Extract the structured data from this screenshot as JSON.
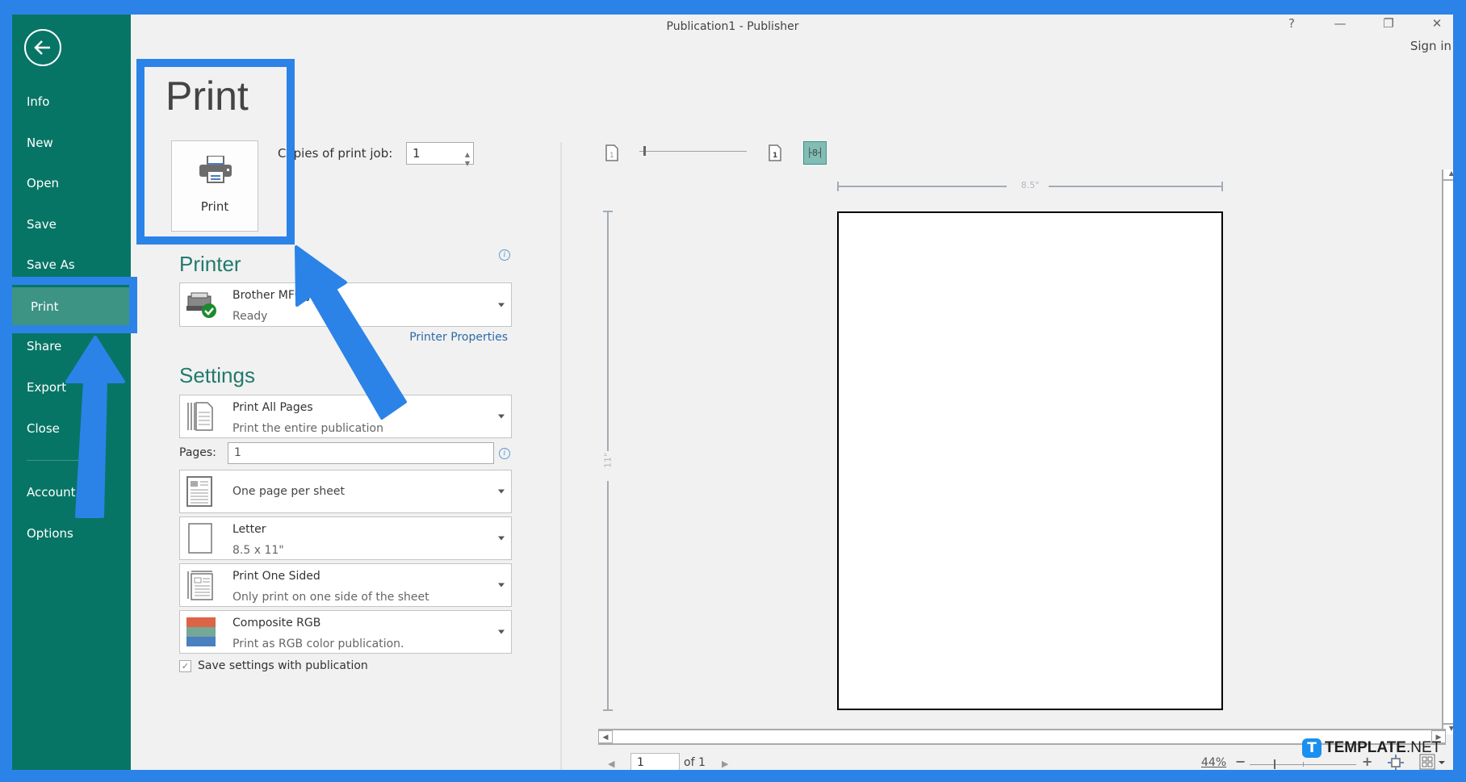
{
  "window": {
    "title": "Publication1 - Publisher",
    "controls": {
      "help": "?",
      "minimize": "—",
      "restore": "❐",
      "close": "✕"
    },
    "sign_in": "Sign in"
  },
  "sidebar": {
    "back_icon": "back-arrow-icon",
    "items": [
      {
        "label": "Info"
      },
      {
        "label": "New"
      },
      {
        "label": "Open"
      },
      {
        "label": "Save"
      },
      {
        "label": "Save As"
      },
      {
        "label": "Print",
        "active": true
      },
      {
        "label": "Share"
      },
      {
        "label": "Export"
      },
      {
        "label": "Close"
      },
      {
        "label": "Account"
      },
      {
        "label": "Options"
      }
    ]
  },
  "print": {
    "title": "Print",
    "button_label": "Print",
    "copies_label": "Copies of print job:",
    "copies_value": "1"
  },
  "printer": {
    "heading": "Printer",
    "name": "Brother MFC-J200",
    "status": "Ready",
    "properties_link": "Printer Properties"
  },
  "settings": {
    "heading": "Settings",
    "print_range": {
      "title": "Print All Pages",
      "subtitle": "Print the entire publication"
    },
    "pages_label": "Pages:",
    "pages_value": "1",
    "layout": {
      "title": "One page per sheet"
    },
    "paper": {
      "title": "Letter",
      "subtitle": "8.5 x 11\""
    },
    "sides": {
      "title": "Print One Sided",
      "subtitle": "Only print on one side of the sheet"
    },
    "color": {
      "title": "Composite RGB",
      "subtitle": "Print as RGB color publication.",
      "swatches": [
        "#de6447",
        "#75a896",
        "#4a80c0"
      ]
    },
    "save_settings_label": "Save settings with publication",
    "save_settings_checked": true
  },
  "preview": {
    "fit_label": "8",
    "ruler_width_label": "8.5\"",
    "ruler_height_label": "11\"",
    "page_current": "1",
    "page_of": "of 1",
    "zoom_percent": "44%",
    "zoom_minus": "−",
    "zoom_plus": "+"
  },
  "watermark": {
    "logo_letter": "T",
    "brand_bold": "TEMPLATE",
    "brand_light": ".NET"
  },
  "colors": {
    "sidebar_bg": "#077566",
    "sidebar_active": "#3d9384",
    "accent_heading": "#227a6e",
    "annotation_blue": "#2b83e8",
    "link": "#2c6aa8"
  }
}
